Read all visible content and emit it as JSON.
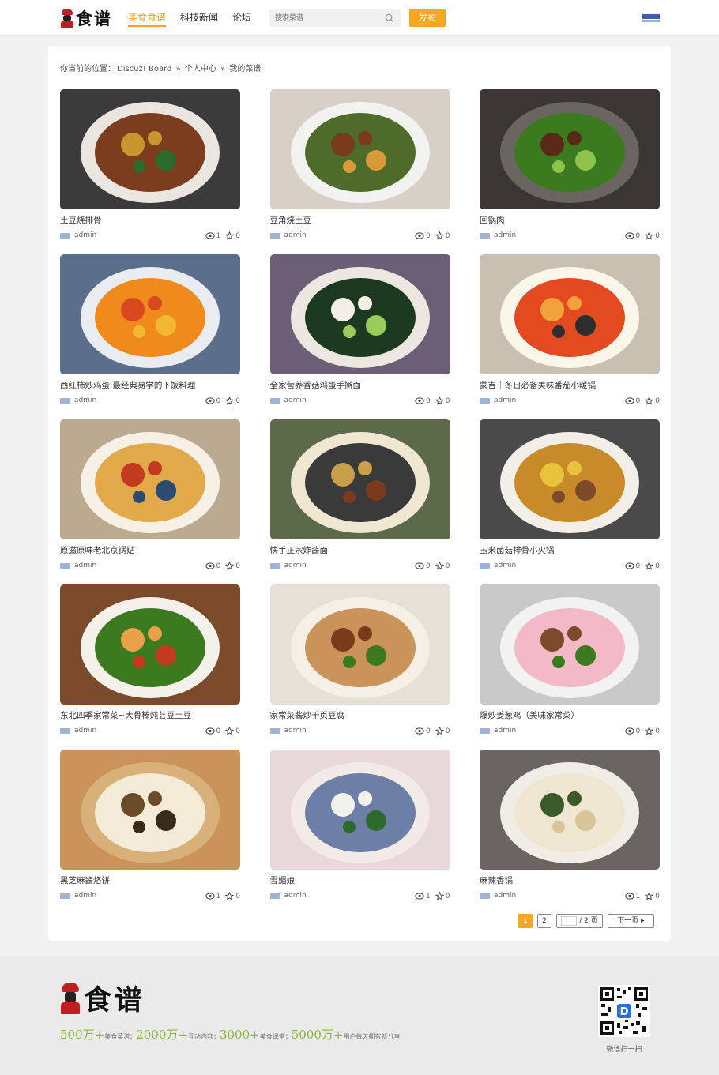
{
  "header": {
    "logo_text": "食谱",
    "nav": [
      "美食食谱",
      "科技新闻",
      "论坛"
    ],
    "search_placeholder": "搜索菜谱",
    "publish_label": "发布"
  },
  "breadcrumb": {
    "prefix": "你当前的位置：",
    "items": [
      "Discuz! Board",
      "»",
      "个人中心",
      "»",
      "我的菜谱"
    ]
  },
  "recipes": [
    {
      "title": "土豆烧排骨",
      "author": "admin",
      "views": "1",
      "likes": "0"
    },
    {
      "title": "豆角烧土豆",
      "author": "admin",
      "views": "0",
      "likes": "0"
    },
    {
      "title": "回锅肉",
      "author": "admin",
      "views": "0",
      "likes": "0"
    },
    {
      "title": "西红柿炒鸡蛋·最经典易学的下饭料理",
      "author": "admin",
      "views": "0",
      "likes": "0"
    },
    {
      "title": "全家营养香菇鸡蛋手擀面",
      "author": "admin",
      "views": "0",
      "likes": "0"
    },
    {
      "title": "蒙吉｜冬日必备美味番茄小暖锅",
      "author": "admin",
      "views": "0",
      "likes": "0"
    },
    {
      "title": "原滋原味老北京锅贴",
      "author": "admin",
      "views": "0",
      "likes": "0"
    },
    {
      "title": "快手正宗炸酱面",
      "author": "admin",
      "views": "0",
      "likes": "0"
    },
    {
      "title": "玉米菌菇排骨小火锅",
      "author": "admin",
      "views": "0",
      "likes": "0"
    },
    {
      "title": "东北四季家常菜~大骨棒炖芸豆土豆",
      "author": "admin",
      "views": "0",
      "likes": "0"
    },
    {
      "title": "家常菜酱炒千页豆腐",
      "author": "admin",
      "views": "0",
      "likes": "0"
    },
    {
      "title": "爆炒姜葱鸡（美味家常菜）",
      "author": "admin",
      "views": "0",
      "likes": "0"
    },
    {
      "title": "黑芝麻酱烙饼",
      "author": "admin",
      "views": "1",
      "likes": "0"
    },
    {
      "title": "雪媚娘",
      "author": "admin",
      "views": "1",
      "likes": "0"
    },
    {
      "title": "麻辣香锅",
      "author": "admin",
      "views": "1",
      "likes": "0"
    }
  ],
  "pagination": {
    "current": "1",
    "page2": "2",
    "total_label": "/ 2 页",
    "next_label": "下一页"
  },
  "footer": {
    "logo_text": "食谱",
    "stats": [
      {
        "num": "500万+",
        "label": "美食菜谱；"
      },
      {
        "num": "2000万+",
        "label": "互动内容；"
      },
      {
        "num": "3000+",
        "label": "美食课堂；"
      },
      {
        "num": "5000万+",
        "label": "用户每天都有新分享"
      }
    ],
    "qr_label": "微信扫一扫"
  }
}
